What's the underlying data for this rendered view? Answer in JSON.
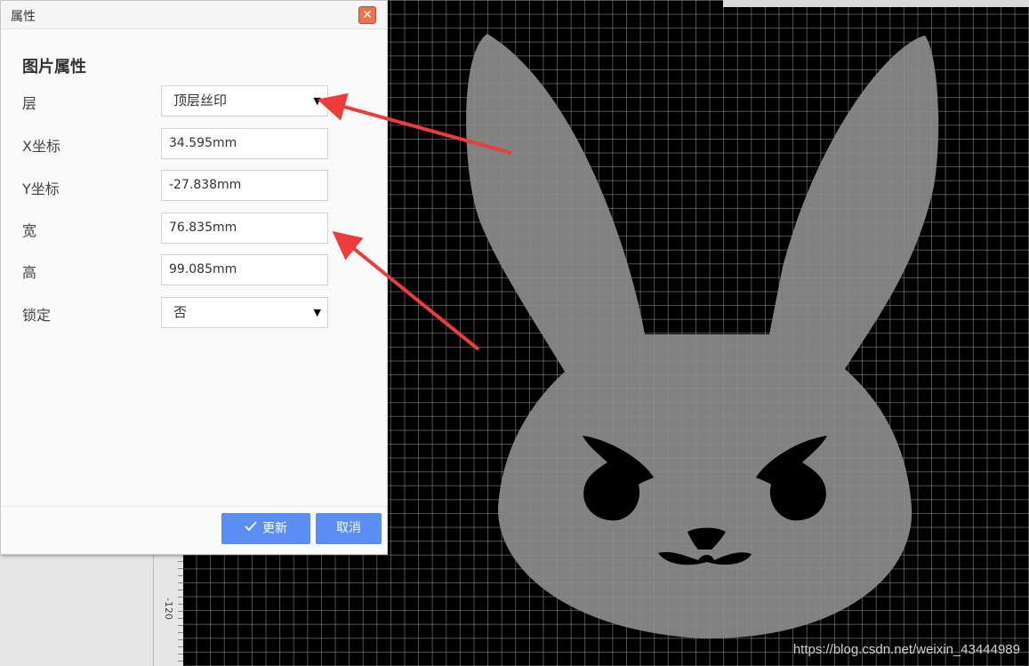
{
  "dialog": {
    "title": "属性",
    "close_icon": "close-icon",
    "section_title": "图片属性",
    "fields": {
      "layer": {
        "label": "层",
        "value": "顶层丝印"
      },
      "x": {
        "label": "X坐标",
        "value": "34.595mm"
      },
      "y": {
        "label": "Y坐标",
        "value": "-27.838mm"
      },
      "width": {
        "label": "宽",
        "value": "76.835mm"
      },
      "height": {
        "label": "高",
        "value": "99.085mm"
      },
      "lock": {
        "label": "锁定",
        "value": "否"
      }
    },
    "buttons": {
      "update": "更新",
      "cancel": "取消"
    }
  },
  "ruler": {
    "label": "-120"
  },
  "watermark": "https://blog.csdn.net/weixin_43444989",
  "colors": {
    "accent": "#5b8ef5",
    "close": "#e8734f",
    "canvas": "#000000",
    "shape": "#8c8c8c",
    "arrow": "#ee3b3b"
  }
}
